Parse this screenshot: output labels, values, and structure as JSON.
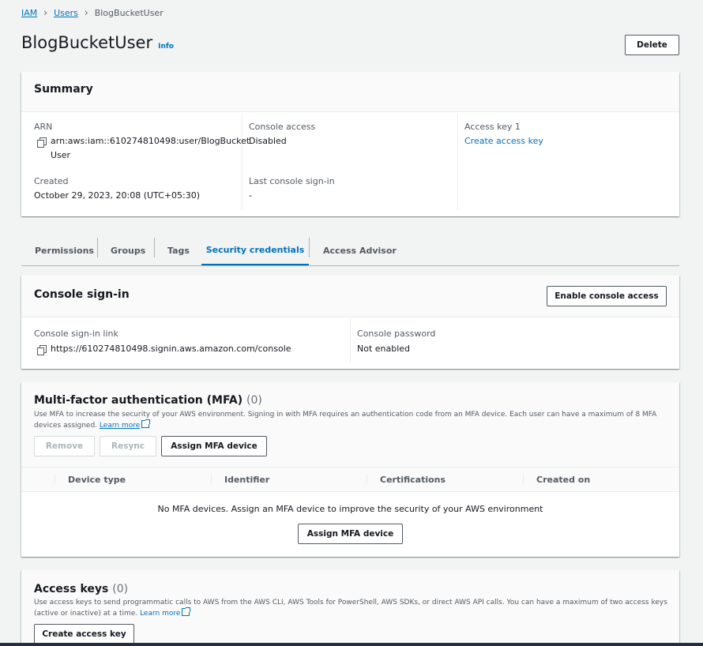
{
  "breadcrumb": {
    "iam": "IAM",
    "users": "Users",
    "current": "BlogBucketUser"
  },
  "header": {
    "title": "BlogBucketUser",
    "info": "Info",
    "delete_label": "Delete"
  },
  "summary": {
    "title": "Summary",
    "arn_label": "ARN",
    "arn_line1": "arn:aws:iam::610274810498:user/BlogBucket",
    "arn_line2": "User",
    "created_label": "Created",
    "created_value": "October 29, 2023, 20:08 (UTC+05:30)",
    "console_access_label": "Console access",
    "console_access_value": "Disabled",
    "last_signin_label": "Last console sign-in",
    "last_signin_value": "-",
    "access_key_label": "Access key 1",
    "access_key_link": "Create access key"
  },
  "tabs": [
    {
      "label": "Permissions"
    },
    {
      "label": "Groups"
    },
    {
      "label": "Tags"
    },
    {
      "label": "Security credentials"
    },
    {
      "label": "Access Advisor"
    }
  ],
  "console_signin": {
    "title": "Console sign-in",
    "enable_label": "Enable console access",
    "link_label": "Console sign-in link",
    "link_value": "https://610274810498.signin.aws.amazon.com/console",
    "password_label": "Console password",
    "password_value": "Not enabled"
  },
  "mfa": {
    "title": "Multi-factor authentication (MFA)",
    "count": "(0)",
    "description": "Use MFA to increase the security of your AWS environment. Signing in with MFA requires an authentication code from an MFA device. Each user can have a maximum of 8 MFA devices assigned.",
    "learn_more": "Learn more",
    "remove_label": "Remove",
    "resync_label": "Resync",
    "assign_label": "Assign MFA device",
    "columns": [
      "Device type",
      "Identifier",
      "Certifications",
      "Created on"
    ],
    "empty_message": "No MFA devices. Assign an MFA device to improve the security of your AWS environment",
    "empty_assign_label": "Assign MFA device"
  },
  "access_keys": {
    "title": "Access keys",
    "count": "(0)",
    "description": "Use access keys to send programmatic calls to AWS from the AWS CLI, AWS Tools for PowerShell, AWS SDKs, or direct AWS API calls. You can have a maximum of two access keys (active or inactive) at a time.",
    "learn_more": "Learn more",
    "create_label": "Create access key"
  },
  "colors": {
    "accent": "#0073bb",
    "text": "#16191f",
    "muted": "#545b64",
    "background": "#f2f3f3"
  },
  "icons": [
    "chevron-right-icon",
    "copy-icon",
    "external-link-icon"
  ]
}
